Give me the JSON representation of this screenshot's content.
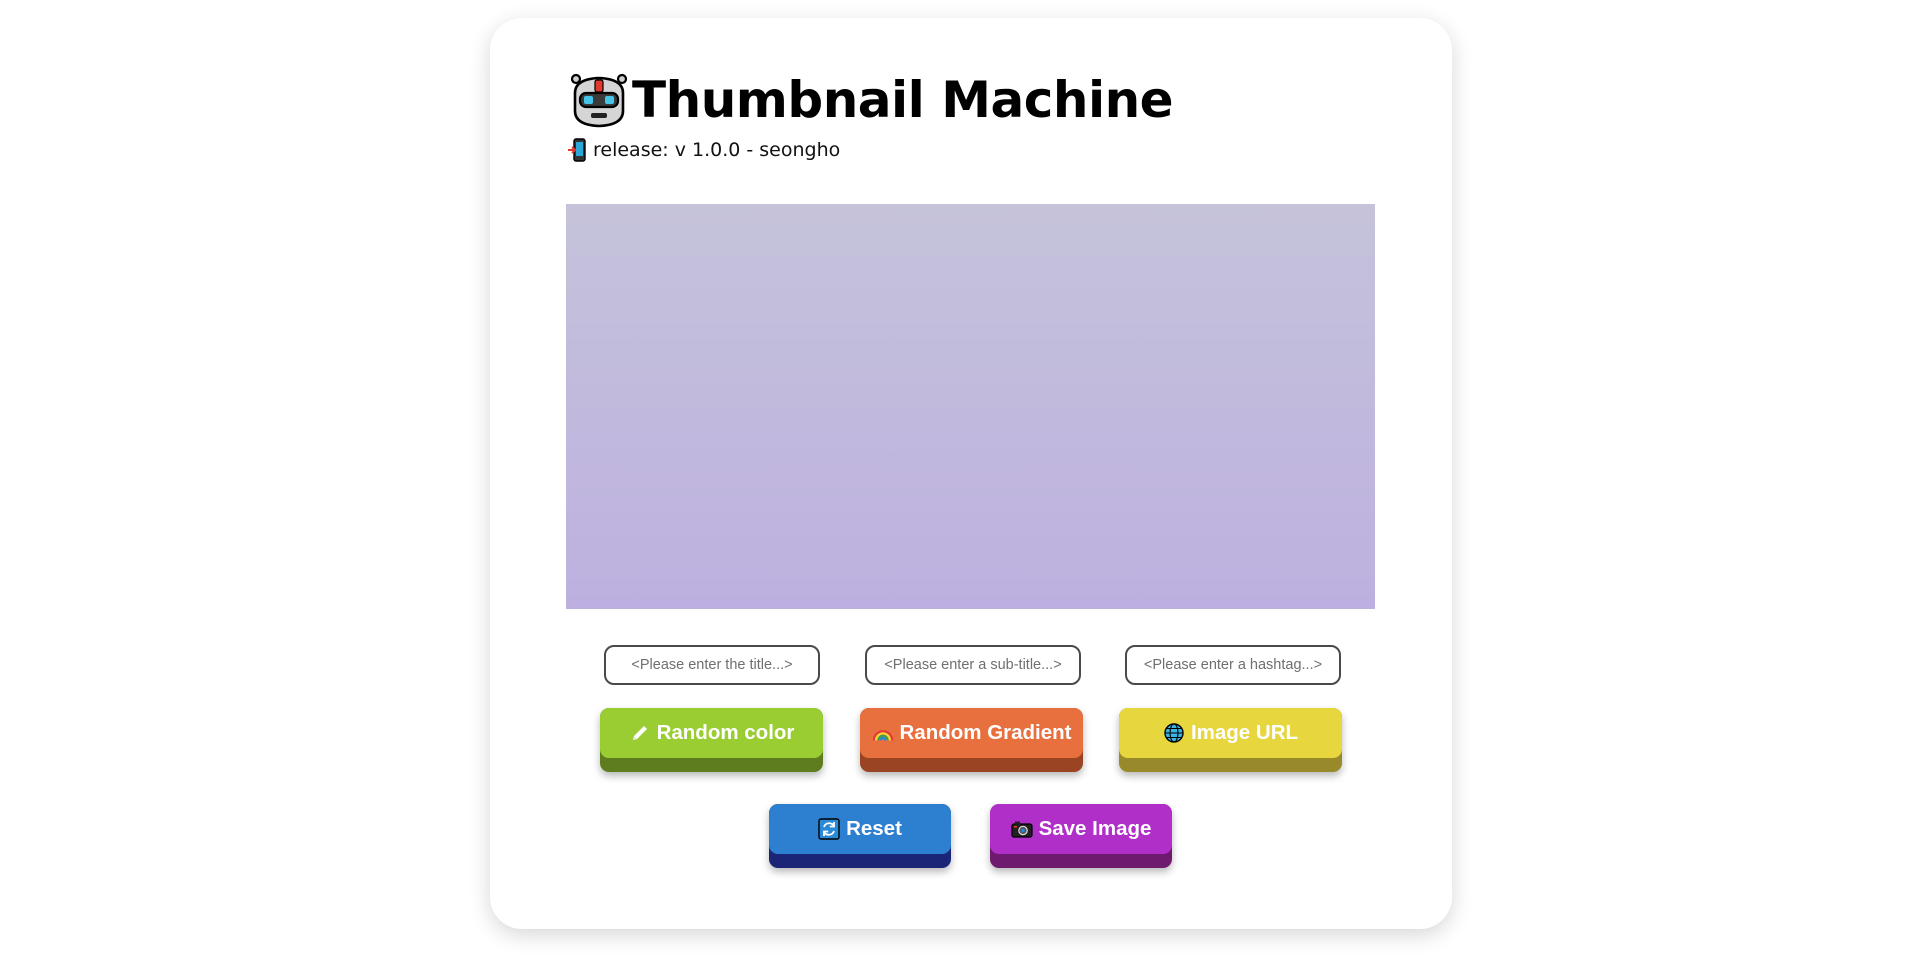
{
  "header": {
    "title": "Thumbnail Machine",
    "release": "release: v 1.0.0 - seongho",
    "robot_icon": "robot-icon",
    "phone_icon": "mobile-phone-arrow-icon"
  },
  "preview": {
    "gradient_top": "#c5c3da",
    "gradient_bottom": "#bdb0e0"
  },
  "inputs": {
    "title_placeholder": "<Please enter the title...>",
    "title_value": "",
    "subtitle_placeholder": "<Please enter a sub-title...>",
    "subtitle_value": "",
    "hashtag_placeholder": "<Please enter a hashtag...>",
    "hashtag_value": ""
  },
  "buttons": {
    "random_color": {
      "label": "Random color",
      "icon": "pencil-icon",
      "color": "#9acd32",
      "shade": "#5e7d1f"
    },
    "random_gradient": {
      "label": "Random Gradient",
      "icon": "rainbow-icon",
      "color": "#e8703f",
      "shade": "#9b4424"
    },
    "image_url": {
      "label": "Image URL",
      "icon": "globe-icon",
      "color": "#e8d63f",
      "shade": "#98892a"
    },
    "reset": {
      "label": "Reset",
      "icon": "refresh-icon",
      "color": "#2d7fd0",
      "shade": "#1b2577"
    },
    "save_image": {
      "label": "Save Image",
      "icon": "camera-icon",
      "color": "#b02fc8",
      "shade": "#6e1a6e"
    }
  }
}
